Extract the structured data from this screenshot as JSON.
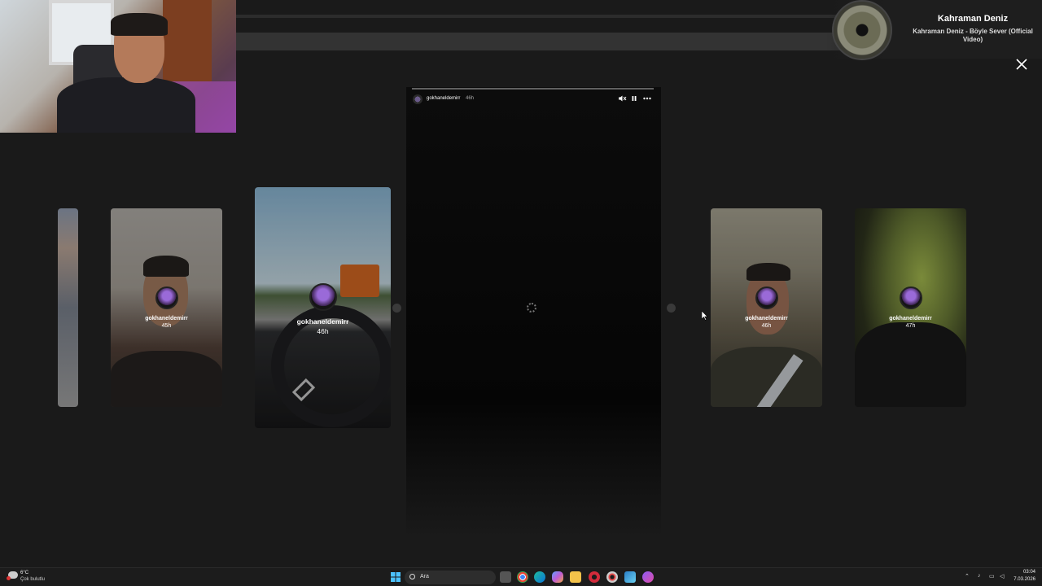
{
  "now_playing": {
    "artist": "Kahraman Deniz",
    "song": "Kahraman Deniz - Böyle Sever (Official Video)"
  },
  "viewer": {
    "username": "gokhaneldemirr",
    "age": "46h",
    "controls": [
      "mute-icon",
      "pause-icon",
      "more-icon"
    ]
  },
  "stories": [
    {
      "username": "gokhaneldemirr",
      "age": "45h"
    },
    {
      "username": "gokhaneldemirr",
      "age": "46h"
    },
    {
      "username": "gokhaneldemirr",
      "age": "46h"
    },
    {
      "username": "gokhaneldemirr",
      "age": "47h"
    }
  ],
  "taskbar": {
    "weather": {
      "temp": "6°C",
      "condition": "Çok bulutlu"
    },
    "search_placeholder": "Ara",
    "clock": {
      "time": "03:04",
      "date": "7.03.2026"
    },
    "apps": [
      "windows-start",
      "task-view",
      "chrome",
      "edge",
      "copilot",
      "file-explorer",
      "opera-gx",
      "discord-like",
      "steam",
      "messenger"
    ]
  },
  "colors": {
    "background": "#1a1a1a",
    "viewer": "#0c0c0c",
    "taskbar": "#1c1c1c"
  }
}
